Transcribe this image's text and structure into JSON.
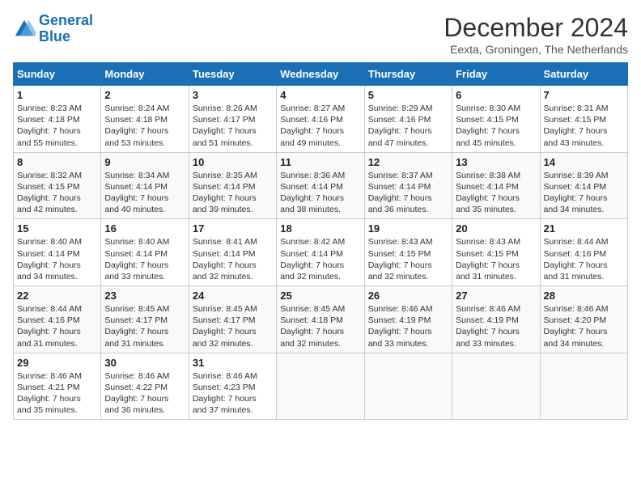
{
  "header": {
    "logo_line1": "General",
    "logo_line2": "Blue",
    "month_title": "December 2024",
    "subtitle": "Eexta, Groningen, The Netherlands"
  },
  "days_of_week": [
    "Sunday",
    "Monday",
    "Tuesday",
    "Wednesday",
    "Thursday",
    "Friday",
    "Saturday"
  ],
  "weeks": [
    [
      {
        "day": "1",
        "sunrise": "8:23 AM",
        "sunset": "4:18 PM",
        "daylight": "7 hours and 55 minutes."
      },
      {
        "day": "2",
        "sunrise": "8:24 AM",
        "sunset": "4:18 PM",
        "daylight": "7 hours and 53 minutes."
      },
      {
        "day": "3",
        "sunrise": "8:26 AM",
        "sunset": "4:17 PM",
        "daylight": "7 hours and 51 minutes."
      },
      {
        "day": "4",
        "sunrise": "8:27 AM",
        "sunset": "4:16 PM",
        "daylight": "7 hours and 49 minutes."
      },
      {
        "day": "5",
        "sunrise": "8:29 AM",
        "sunset": "4:16 PM",
        "daylight": "7 hours and 47 minutes."
      },
      {
        "day": "6",
        "sunrise": "8:30 AM",
        "sunset": "4:15 PM",
        "daylight": "7 hours and 45 minutes."
      },
      {
        "day": "7",
        "sunrise": "8:31 AM",
        "sunset": "4:15 PM",
        "daylight": "7 hours and 43 minutes."
      }
    ],
    [
      {
        "day": "8",
        "sunrise": "8:32 AM",
        "sunset": "4:15 PM",
        "daylight": "7 hours and 42 minutes."
      },
      {
        "day": "9",
        "sunrise": "8:34 AM",
        "sunset": "4:14 PM",
        "daylight": "7 hours and 40 minutes."
      },
      {
        "day": "10",
        "sunrise": "8:35 AM",
        "sunset": "4:14 PM",
        "daylight": "7 hours and 39 minutes."
      },
      {
        "day": "11",
        "sunrise": "8:36 AM",
        "sunset": "4:14 PM",
        "daylight": "7 hours and 38 minutes."
      },
      {
        "day": "12",
        "sunrise": "8:37 AM",
        "sunset": "4:14 PM",
        "daylight": "7 hours and 36 minutes."
      },
      {
        "day": "13",
        "sunrise": "8:38 AM",
        "sunset": "4:14 PM",
        "daylight": "7 hours and 35 minutes."
      },
      {
        "day": "14",
        "sunrise": "8:39 AM",
        "sunset": "4:14 PM",
        "daylight": "7 hours and 34 minutes."
      }
    ],
    [
      {
        "day": "15",
        "sunrise": "8:40 AM",
        "sunset": "4:14 PM",
        "daylight": "7 hours and 34 minutes."
      },
      {
        "day": "16",
        "sunrise": "8:40 AM",
        "sunset": "4:14 PM",
        "daylight": "7 hours and 33 minutes."
      },
      {
        "day": "17",
        "sunrise": "8:41 AM",
        "sunset": "4:14 PM",
        "daylight": "7 hours and 32 minutes."
      },
      {
        "day": "18",
        "sunrise": "8:42 AM",
        "sunset": "4:14 PM",
        "daylight": "7 hours and 32 minutes."
      },
      {
        "day": "19",
        "sunrise": "8:43 AM",
        "sunset": "4:15 PM",
        "daylight": "7 hours and 32 minutes."
      },
      {
        "day": "20",
        "sunrise": "8:43 AM",
        "sunset": "4:15 PM",
        "daylight": "7 hours and 31 minutes."
      },
      {
        "day": "21",
        "sunrise": "8:44 AM",
        "sunset": "4:16 PM",
        "daylight": "7 hours and 31 minutes."
      }
    ],
    [
      {
        "day": "22",
        "sunrise": "8:44 AM",
        "sunset": "4:16 PM",
        "daylight": "7 hours and 31 minutes."
      },
      {
        "day": "23",
        "sunrise": "8:45 AM",
        "sunset": "4:17 PM",
        "daylight": "7 hours and 31 minutes."
      },
      {
        "day": "24",
        "sunrise": "8:45 AM",
        "sunset": "4:17 PM",
        "daylight": "7 hours and 32 minutes."
      },
      {
        "day": "25",
        "sunrise": "8:45 AM",
        "sunset": "4:18 PM",
        "daylight": "7 hours and 32 minutes."
      },
      {
        "day": "26",
        "sunrise": "8:46 AM",
        "sunset": "4:19 PM",
        "daylight": "7 hours and 33 minutes."
      },
      {
        "day": "27",
        "sunrise": "8:46 AM",
        "sunset": "4:19 PM",
        "daylight": "7 hours and 33 minutes."
      },
      {
        "day": "28",
        "sunrise": "8:46 AM",
        "sunset": "4:20 PM",
        "daylight": "7 hours and 34 minutes."
      }
    ],
    [
      {
        "day": "29",
        "sunrise": "8:46 AM",
        "sunset": "4:21 PM",
        "daylight": "7 hours and 35 minutes."
      },
      {
        "day": "30",
        "sunrise": "8:46 AM",
        "sunset": "4:22 PM",
        "daylight": "7 hours and 36 minutes."
      },
      {
        "day": "31",
        "sunrise": "8:46 AM",
        "sunset": "4:23 PM",
        "daylight": "7 hours and 37 minutes."
      },
      null,
      null,
      null,
      null
    ]
  ]
}
